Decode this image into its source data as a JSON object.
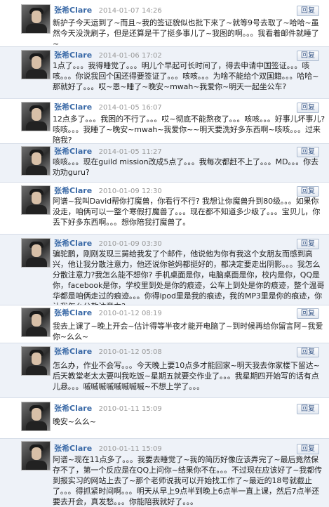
{
  "reply_label": "回复",
  "messages": [
    {
      "name": "张希Clare",
      "time": "2014-01-07 14:26",
      "text": "新护子今天运到了~而且~我的签证貌似也批下来了~就等9号去取了~哈哈~虽然今天没洗刷子，但是还算是干了挺多事儿了~我图的啊。。。我看着邮件就睡了~"
    },
    {
      "name": "张希Clare",
      "time": "2014-01-06 17:02",
      "text": "1点了。。。我得睡觉了。。。明儿个早起可长时间了，得去申请中国签证。。。咳咳。。。你说我回个国还得要签证了。。。咳咳。。。为啥不能给个双国籍。。。哈哈~那就好了。。。哎~恩~睡了~晚安~mwah~我爱你~明天一起坐公车?"
    },
    {
      "name": "张希Clare",
      "time": "2014-01-05 16:07",
      "text": "12点多了。。。我困的不行了。。。哎~彻底不能熬夜了。。。咳咳。。。好事儿坏事儿?咳咳。。。我睡了~晚安~mwah~我爱你~~明天要洗好多东西啊~咳咳。。。过来陪我?"
    },
    {
      "name": "张希Clare",
      "time": "2014-01-05 11:27",
      "text": "咳咳。。。现在guild mission改成5点了。。。我每次都赶不上了。。。MD。。。你去劝劝guru?"
    },
    {
      "name": "张希Clare",
      "time": "2010-01-09 12:30",
      "text": "阿谱~我叫David帮你打魔兽，你看行不行? 我想让你魔兽升到80级。。。如果你没走，咱俩可以一整个寒假打魔兽了。。。现在都不知道多少级了。。。宝贝儿，你丢下好多东西啊。。。想你陪我打魔兽了。"
    },
    {
      "name": "张希Clare",
      "time": "2010-01-09 03:30",
      "text": "骗驼鹏，刚刚发现三舅给我发了个邮件，他说他为你有我这个女朋友而感到高兴，他让我分散注意力，他还说你爸妈都挺好的，都决定要走出阴影。。。我怎么分散注意力?我怎么能不想你? 手机桌面是你，电脑桌面是你，校内是你，QQ是你，facebook是你，学校里到处是你的痕迹，公车上到处是你的痕迹，整个温哥华都是咱俩走过的痕迹。。。你得ipod里是我的痕迹，我的MP3里是你的痕迹，你让我怎么分散注意力?"
    },
    {
      "name": "张希Clare",
      "time": "2010-01-12 08:19",
      "text": "我去上课了~晚上开会~估计得等半夜才能开电脑了~到时候再给你留言阿~我爱你~么么~"
    },
    {
      "name": "张希Clare",
      "time": "2010-01-12 05:08",
      "text": "怎么办，作业不会写。。。今天晚上要10点多才能回家~明天我去你家楼下留达~后天教堂老太太要叫我吃饭~星期五就要交作业了。。。我星期四开始写的话有点儿悬。。。嘁嘁嘁嘁嘁嘁嘁嘁~不想上学了。。。"
    },
    {
      "name": "张希Clare",
      "time": "2010-01-11 15:09",
      "text": "晚安~么么~"
    },
    {
      "name": "张希Clare",
      "time": "2010-01-11 15:09",
      "text": "阿谱~现在11点多了。。。我要去睡觉了~我的简历好像应该弄完了~最后竟然保存不了，第一个反应是在QQ上问你~结果你不在。。。不过现在应该好了~我都传到报实习的网站上去了~那个老师说我可以开始找工作了~最近的18号就截止了。。。得抓紧时间啊。。。明天从早上9点半到晚上6点半一直上课，然后7点半还要去开会，真发愁。。。你能陪我就好了。。。"
    }
  ]
}
